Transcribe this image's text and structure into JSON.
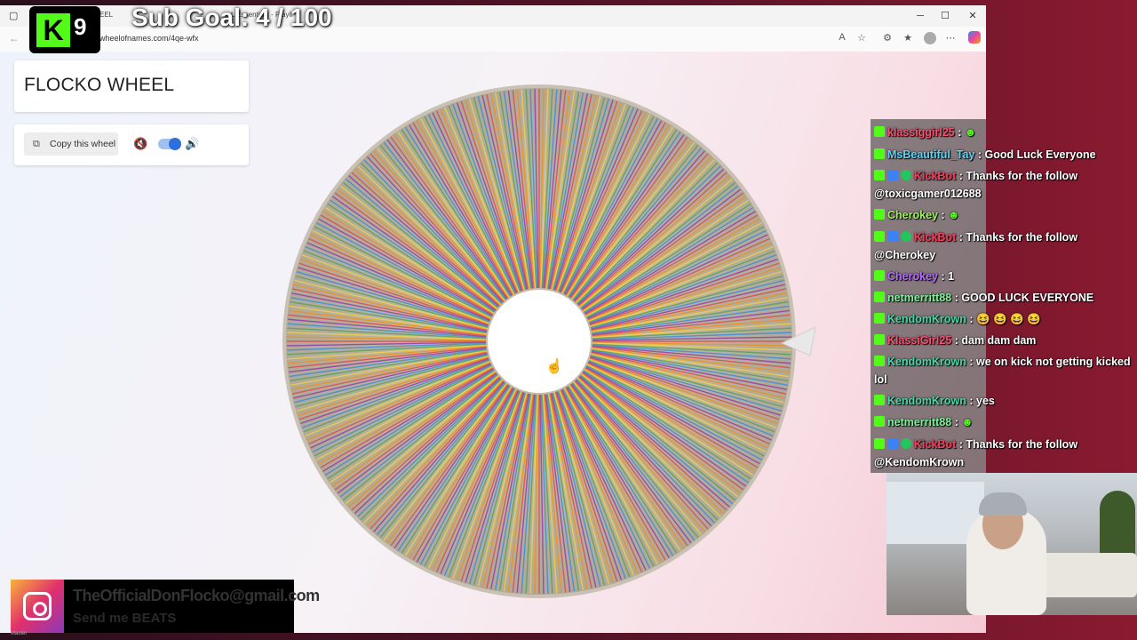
{
  "browser": {
    "tabs": [
      "EEL",
      "L Essentials - Playli"
    ],
    "url": "wheelofnames.com/4qe-wfx",
    "window_controls": [
      "minimize",
      "maximize",
      "close"
    ]
  },
  "page": {
    "title": "FLOCKO WHEEL",
    "copy_button_label": "Copy this wheel",
    "sound_toggle_on": true
  },
  "wheel": {
    "description_segments_rainbow": true,
    "colors": [
      "#e53935",
      "#fb8c00",
      "#fdd835",
      "#43a047",
      "#1e88e5",
      "#8e24aa"
    ]
  },
  "overlay": {
    "kick_count": "9",
    "sub_goal": "Sub Goal: 4 / 100",
    "instagram_email": "TheOfficialDonFlocko@gmail.com",
    "instagram_send": "Send me BEATS",
    "taskbar_tag": "Master"
  },
  "chat": [
    {
      "user": "klassiggirl25",
      "text": ": ",
      "color": "#ff4d6d",
      "badges": [
        "kick"
      ],
      "emote": true
    },
    {
      "user": "MsBeautiful_Tay",
      "text": ": Good Luck Everyone",
      "color": "#5fd3f3",
      "badges": [
        "kick"
      ]
    },
    {
      "user": "KickBot",
      "text": ": Thanks for the follow",
      "cont": "@toxicgamer012688",
      "color": "#ff3b5c",
      "badges": [
        "kick",
        "mod",
        "ver"
      ]
    },
    {
      "user": "Cherokey",
      "text": ": ",
      "color": "#9ef55a",
      "badges": [
        "kick"
      ],
      "emote": true
    },
    {
      "user": "KickBot",
      "text": ": Thanks for the follow",
      "cont": "@Cherokey",
      "color": "#ff3b5c",
      "badges": [
        "kick",
        "mod",
        "ver"
      ]
    },
    {
      "user": "Cherokey",
      "text": ": 1",
      "color": "#b56cff",
      "badges": [
        "kick"
      ]
    },
    {
      "user": "netmerritt88",
      "text": ": GOOD LUCK EVERYONE",
      "color": "#7ef29a",
      "badges": [
        "kick"
      ]
    },
    {
      "user": "KendomKrown",
      "text": ": 😆 😆 😆 😆",
      "color": "#4dd6a8",
      "badges": [
        "kick"
      ]
    },
    {
      "user": "KlassiGirl25",
      "text": ": dam dam dam",
      "color": "#ff4d6d",
      "badges": [
        "kick"
      ]
    },
    {
      "user": "KendomKrown",
      "text": ": we on kick not getting kicked",
      "cont": "lol",
      "color": "#4dd6a8",
      "badges": [
        "kick"
      ]
    },
    {
      "user": "KendomKrown",
      "text": ": yes",
      "color": "#4dd6a8",
      "badges": [
        "kick"
      ]
    },
    {
      "user": "netmerritt88",
      "text": ": ",
      "color": "#7ef29a",
      "badges": [
        "kick"
      ],
      "emote": true
    },
    {
      "user": "KickBot",
      "text": ": Thanks for the follow",
      "cont": "@KendomKrown",
      "color": "#ff3b5c",
      "badges": [
        "kick",
        "mod",
        "ver"
      ]
    }
  ]
}
